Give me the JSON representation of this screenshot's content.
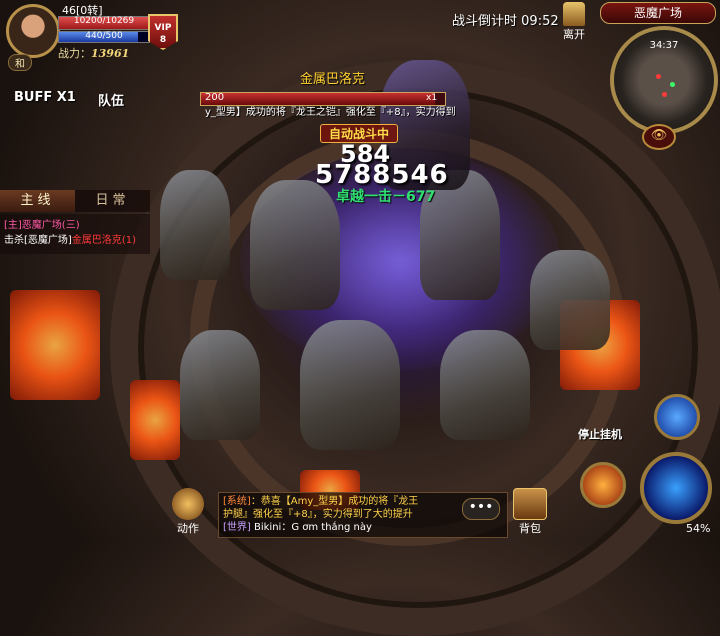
{
  "player": {
    "level": "46[0转]",
    "hp": "10200/10269",
    "hp_fraction": 0.993,
    "mp": "440/500",
    "mp_fraction": 0.88,
    "power_label": "战力：",
    "power_value": "13961",
    "vip_label": "VIP",
    "vip_level": "8",
    "name_tag": "和"
  },
  "buff": "BUFF X1",
  "team": "队伍",
  "quest": {
    "tabs": [
      "主线",
      "日常"
    ],
    "title": "[主]恶魔广场(三)",
    "line_prefix": "击杀[恶魔广场]",
    "line_target": "金属巴洛克",
    "line_count": "(1)"
  },
  "boss": {
    "name": "金属巴洛克",
    "level": "200",
    "multiplier": "x1",
    "hp_fraction": 0.96
  },
  "ticker": "y_型男】成功的将『龙王之铠』强化至『+8』，实力得到",
  "auto_fight": "自动战斗中",
  "damage": {
    "big_top": "584",
    "big": "5788546",
    "green": "卓越一击－677"
  },
  "countdown_label": "战斗倒计时",
  "countdown_time": "09:52",
  "leave": "离开",
  "zone": "恶魔广场",
  "minimap_coords": "34:37",
  "eye_icon": "👁",
  "stop_hang": "停止挂机",
  "action": "动作",
  "chat": {
    "line1_channel": "[系统]",
    "line1_text": "：恭喜【Amy_型男】成功的将『龙王",
    "line2_text": "护腿』强化至『+8』，实力得到了大的提升",
    "line3_channel": "[世界]",
    "line3_user": "Bikini",
    "line3_text": "：G ơm thắng này",
    "more": "•••"
  },
  "bag": "背包",
  "battery": "54%",
  "colors": {
    "accent_gold": "#e8c46a",
    "hp_red": "#c83030",
    "mp_blue": "#3a6ad8",
    "damage_green": "#30e070",
    "quest_pink": "#ff5aa8"
  }
}
